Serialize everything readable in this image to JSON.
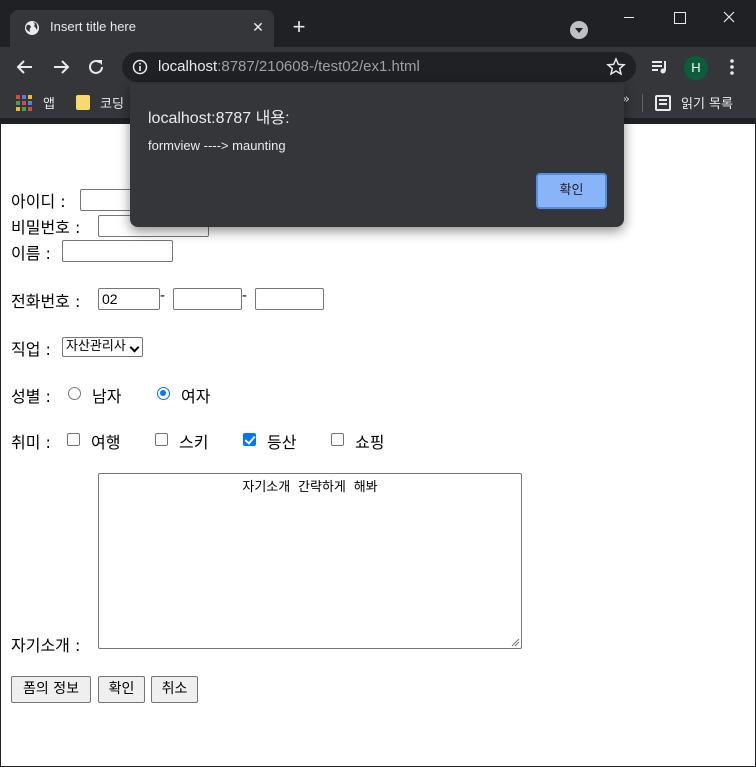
{
  "browser": {
    "tab_title": "Insert title here",
    "url_host": "localhost",
    "url_rest": ":8787/210608-/test02/ex1.html",
    "avatar_letter": "H",
    "bookmarks": {
      "apps_label": "앱",
      "folder_label": "코딩",
      "more": "»",
      "reading_list_label": "읽기 목록"
    }
  },
  "dialog": {
    "title": "localhost:8787 내용:",
    "message": "formview ----> maunting",
    "ok_label": "확인"
  },
  "form": {
    "id_label": "아이디 :",
    "password_label": "비밀번호 :",
    "name_label": "이름 :",
    "phone_label": "전화번호 :",
    "phone_first": "02",
    "phone_sep": "-",
    "job_label": "직업 :",
    "job_selected": "자산관리사",
    "gender_label": "성별 :",
    "gender_options": [
      {
        "label": "남자",
        "checked": false
      },
      {
        "label": "여자",
        "checked": true
      }
    ],
    "hobby_label": "취미 :",
    "hobbies": [
      {
        "label": "여행",
        "checked": false
      },
      {
        "label": "스키",
        "checked": false
      },
      {
        "label": "등산",
        "checked": true
      },
      {
        "label": "쇼핑",
        "checked": false
      }
    ],
    "intro_label": "자기소개 :",
    "intro_text": "자기소개 간략하게 해봐",
    "buttons": {
      "info": "폼의 정보",
      "confirm": "확인",
      "cancel": "취소"
    }
  },
  "colors": {
    "chrome_bg": "#202124",
    "toolbar_bg": "#35363a",
    "accent": "#0075ff",
    "dialog_ok": "#8ab4f8"
  }
}
